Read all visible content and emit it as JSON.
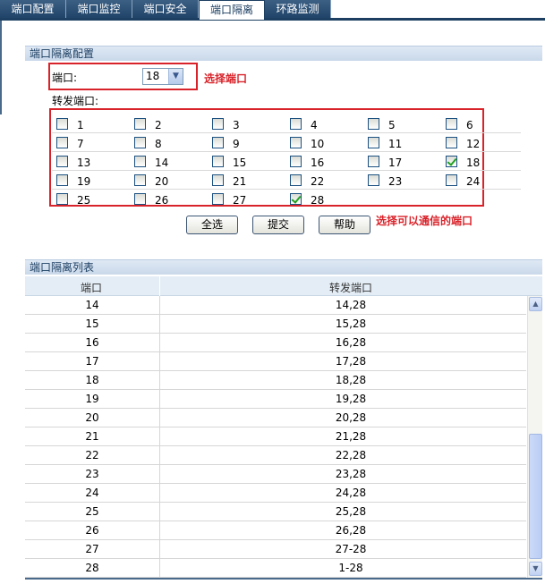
{
  "tabs": [
    {
      "label": "端口配置",
      "active": false
    },
    {
      "label": "端口监控",
      "active": false
    },
    {
      "label": "端口安全",
      "active": false
    },
    {
      "label": "端口隔离",
      "active": true
    },
    {
      "label": "环路监测",
      "active": false
    }
  ],
  "config": {
    "title": "端口隔离配置",
    "port_label": "端口:",
    "port_value": "18",
    "port_annotation": "选择端口",
    "forward_label": "转发端口:",
    "forward_annotation": "选择可以通信的端口",
    "ports": [
      {
        "n": "1",
        "checked": false
      },
      {
        "n": "2",
        "checked": false
      },
      {
        "n": "3",
        "checked": false
      },
      {
        "n": "4",
        "checked": false
      },
      {
        "n": "5",
        "checked": false
      },
      {
        "n": "6",
        "checked": false
      },
      {
        "n": "7",
        "checked": false
      },
      {
        "n": "8",
        "checked": false
      },
      {
        "n": "9",
        "checked": false
      },
      {
        "n": "10",
        "checked": false
      },
      {
        "n": "11",
        "checked": false
      },
      {
        "n": "12",
        "checked": false
      },
      {
        "n": "13",
        "checked": false
      },
      {
        "n": "14",
        "checked": false
      },
      {
        "n": "15",
        "checked": false
      },
      {
        "n": "16",
        "checked": false
      },
      {
        "n": "17",
        "checked": false
      },
      {
        "n": "18",
        "checked": true
      },
      {
        "n": "19",
        "checked": false
      },
      {
        "n": "20",
        "checked": false
      },
      {
        "n": "21",
        "checked": false
      },
      {
        "n": "22",
        "checked": false
      },
      {
        "n": "23",
        "checked": false
      },
      {
        "n": "24",
        "checked": false
      },
      {
        "n": "25",
        "checked": false
      },
      {
        "n": "26",
        "checked": false
      },
      {
        "n": "27",
        "checked": false
      },
      {
        "n": "28",
        "checked": true
      }
    ],
    "buttons": {
      "select_all": "全选",
      "submit": "提交",
      "help": "帮助"
    }
  },
  "list": {
    "title": "端口隔离列表",
    "headers": {
      "port": "端口",
      "forward": "转发端口"
    },
    "rows": [
      {
        "port": "14",
        "forward": "14,28"
      },
      {
        "port": "15",
        "forward": "15,28"
      },
      {
        "port": "16",
        "forward": "16,28"
      },
      {
        "port": "17",
        "forward": "17,28"
      },
      {
        "port": "18",
        "forward": "18,28"
      },
      {
        "port": "19",
        "forward": "19,28"
      },
      {
        "port": "20",
        "forward": "20,28"
      },
      {
        "port": "21",
        "forward": "21,28"
      },
      {
        "port": "22",
        "forward": "22,28"
      },
      {
        "port": "23",
        "forward": "23,28"
      },
      {
        "port": "24",
        "forward": "24,28"
      },
      {
        "port": "25",
        "forward": "25,28"
      },
      {
        "port": "26",
        "forward": "26,28"
      },
      {
        "port": "27",
        "forward": "27-28"
      },
      {
        "port": "28",
        "forward": "1-28"
      }
    ]
  },
  "colors": {
    "accent": "#1d3f62",
    "annotation": "#d8232a",
    "check": "#21a121"
  },
  "icons": {
    "dropdown": "chevron-down-icon",
    "scroll_up": "arrow-up-icon",
    "scroll_down": "arrow-down-icon"
  }
}
